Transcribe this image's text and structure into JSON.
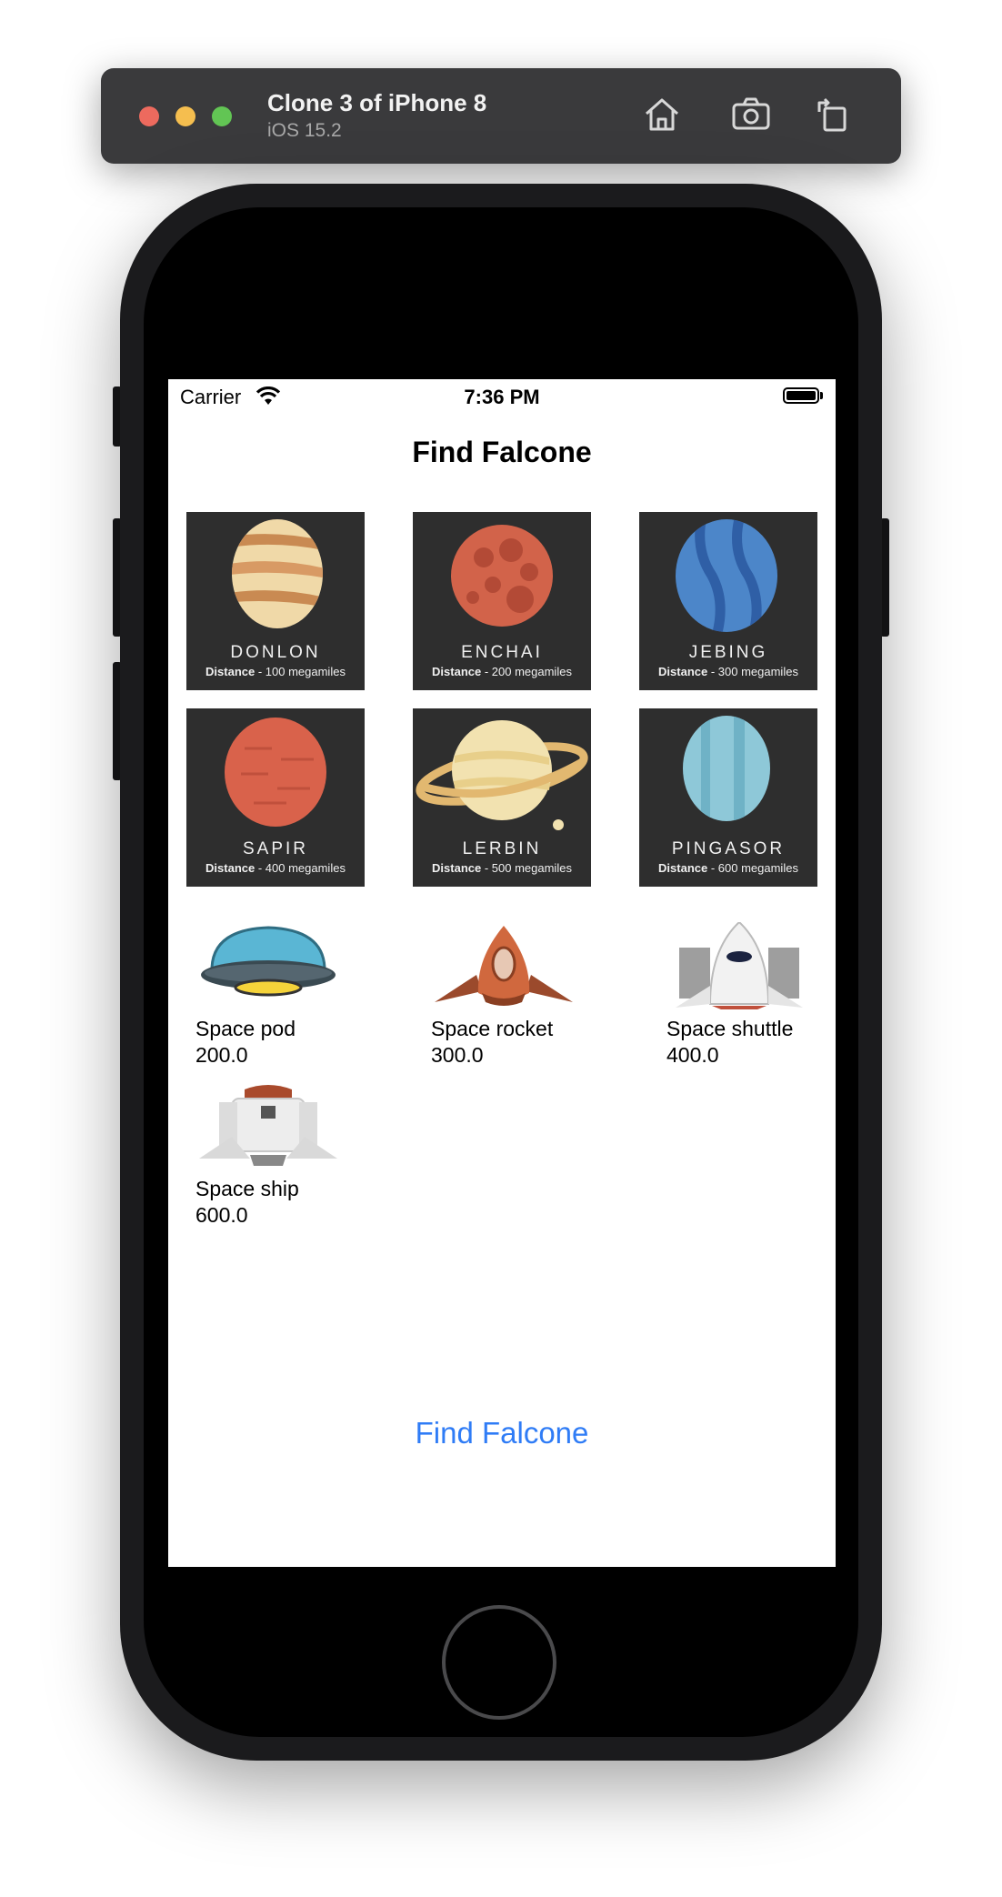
{
  "simulator": {
    "device_name": "Clone 3 of iPhone 8",
    "os_version": "iOS 15.2"
  },
  "status_bar": {
    "carrier": "Carrier",
    "time": "7:36 PM"
  },
  "nav": {
    "title": "Find Falcone"
  },
  "planets": [
    {
      "name": "DONLON",
      "distance_label": "Distance",
      "distance_value": " - 100 megamiles",
      "color": "#f0d9a8",
      "band": "#c98a52"
    },
    {
      "name": "ENCHAI",
      "distance_label": "Distance",
      "distance_value": " - 200 megamiles",
      "color": "#d2634a",
      "band": "#b34a36"
    },
    {
      "name": "JEBING",
      "distance_label": "Distance",
      "distance_value": " - 300 megamiles",
      "color": "#4c86c9",
      "band": "#2f5fa6"
    },
    {
      "name": "SAPIR",
      "distance_label": "Distance",
      "distance_value": " - 400 megamiles",
      "color": "#d9624b",
      "band": "#c0503c"
    },
    {
      "name": "LERBIN",
      "distance_label": "Distance",
      "distance_value": " - 500 megamiles",
      "color": "#f2e2b0",
      "band": "#e2b870"
    },
    {
      "name": "PINGASOR",
      "distance_label": "Distance",
      "distance_value": " - 600 megamiles",
      "color": "#8ec8d8",
      "band": "#6fb2c6"
    }
  ],
  "vehicles": [
    {
      "name": "Space pod",
      "speed": "200.0"
    },
    {
      "name": "Space rocket",
      "speed": "300.0"
    },
    {
      "name": "Space shuttle",
      "speed": "400.0"
    },
    {
      "name": "Space ship",
      "speed": "600.0"
    }
  ],
  "actions": {
    "find_label": "Find Falcone"
  },
  "colors": {
    "accent": "#2f7cf6",
    "tile_bg": "#2e2e2e"
  }
}
